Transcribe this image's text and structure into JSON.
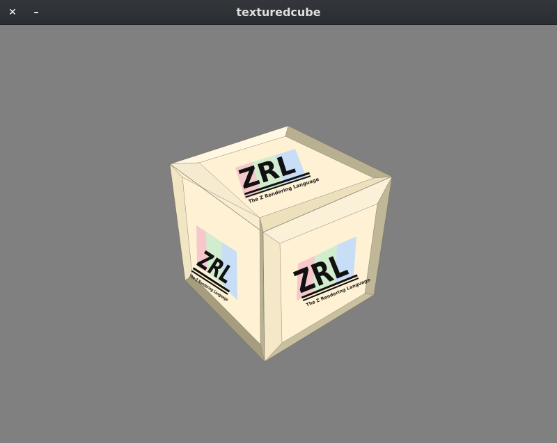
{
  "window": {
    "title": "texturedcube",
    "close_glyph": "✕",
    "minimize_glyph": "–"
  },
  "cube": {
    "logo_mark": "ZRL",
    "logo_caption": "The Z Rendering Language",
    "face_color": "#fff2d4",
    "bevel_light": "#f3e6c3",
    "bevel_dark": "#a49c80",
    "logo_colors": [
      "#f6c8cc",
      "#d2ecce",
      "#c8ddf6"
    ]
  }
}
